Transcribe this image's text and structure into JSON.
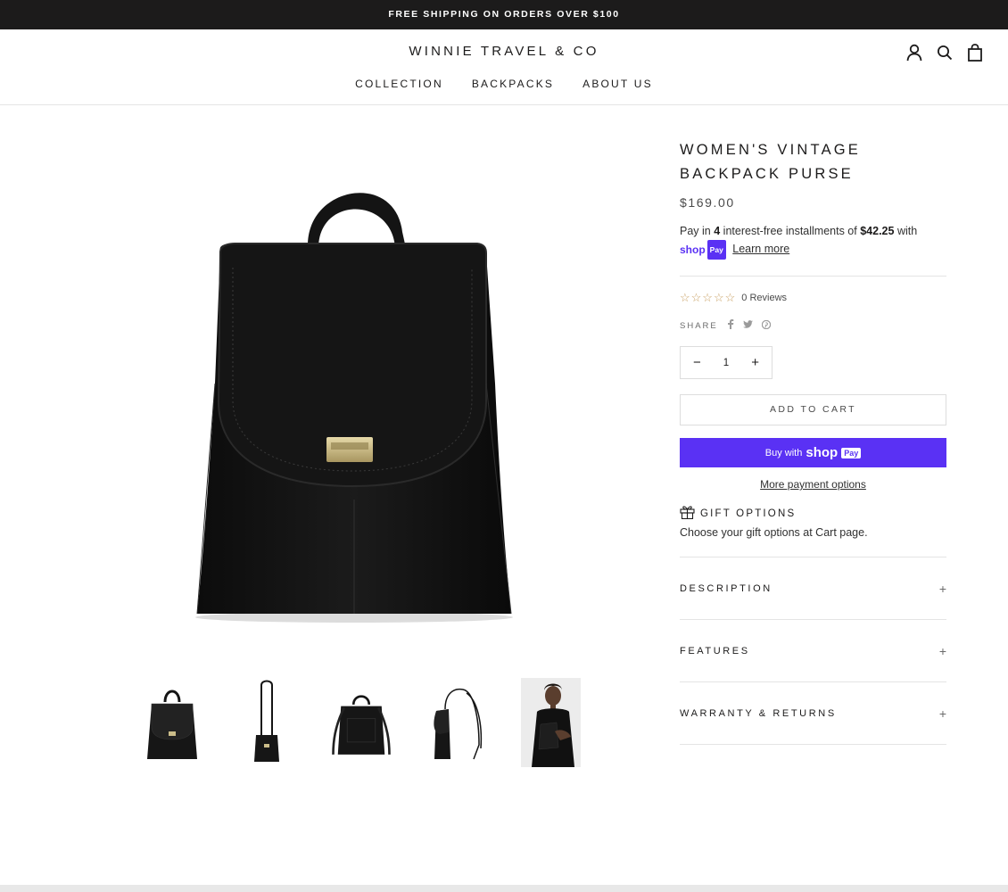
{
  "announcement": "FREE SHIPPING ON ORDERS OVER $100",
  "header": {
    "logo": "WINNIE TRAVEL & CO",
    "nav": [
      "COLLECTION",
      "BACKPACKS",
      "ABOUT US"
    ]
  },
  "product": {
    "title_line1": "WOMEN'S VINTAGE",
    "title_line2": "BACKPACK PURSE",
    "price": "$169.00",
    "installments_prefix": "Pay in",
    "installments_count": "4",
    "installments_middle": "interest-free installments of",
    "installments_amount": "$42.25",
    "installments_suffix": "with",
    "shop_word": "shop",
    "pay_word": "Pay",
    "learn_more": "Learn more",
    "stars": "☆☆☆☆☆",
    "reviews": "0 Reviews",
    "share_label": "SHARE",
    "quantity": "1",
    "add_to_cart": "ADD TO CART",
    "buy_with": "Buy with",
    "more_payment": "More payment options",
    "gift_title": "GIFT OPTIONS",
    "gift_sub": "Choose your gift options at Cart page.",
    "accordions": [
      "DESCRIPTION",
      "FEATURES",
      "WARRANTY & RETURNS"
    ]
  },
  "colors": {
    "brand_dark": "#1c1b1b",
    "shop_pay": "#5a31f4",
    "star": "#c9a063"
  }
}
